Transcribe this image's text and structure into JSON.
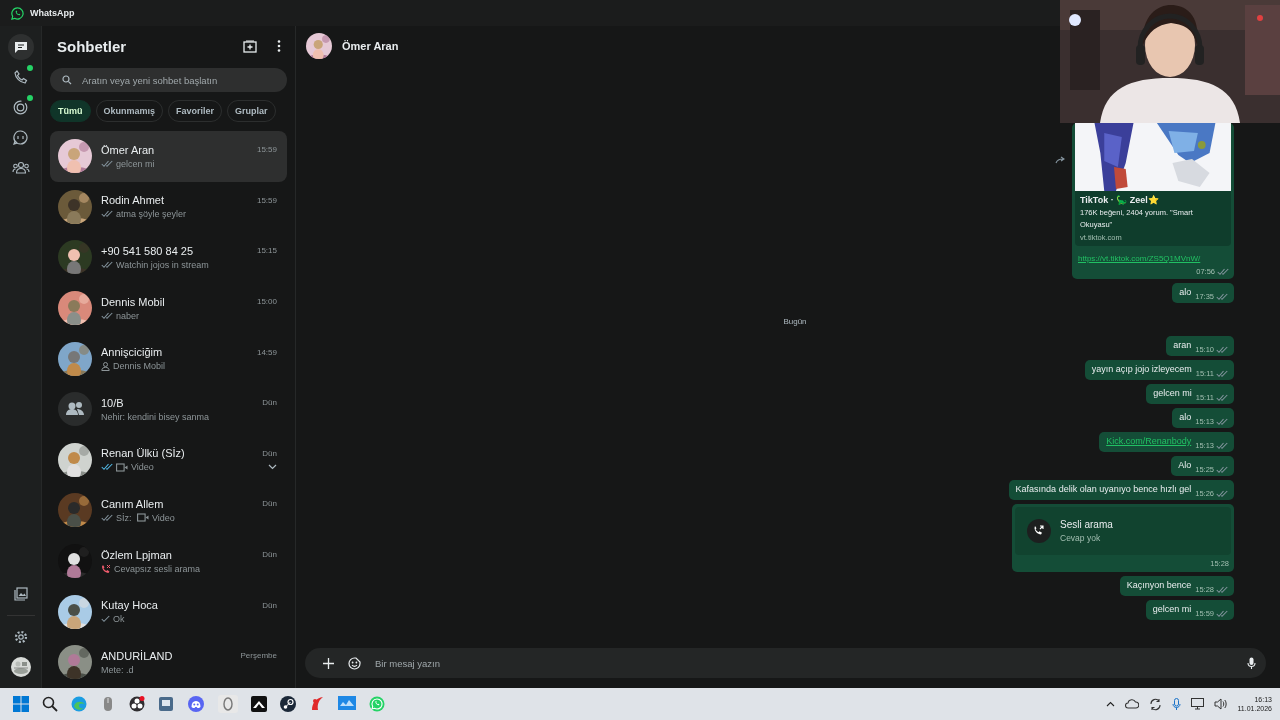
{
  "window": {
    "title": "WhatsApp"
  },
  "rail": {
    "items": [
      {
        "kind": "chats",
        "selected": true,
        "badge": false
      },
      {
        "kind": "calls",
        "selected": false,
        "badge": true
      },
      {
        "kind": "status",
        "selected": false,
        "badge": true
      },
      {
        "kind": "channels",
        "selected": false,
        "badge": false
      },
      {
        "kind": "communities",
        "selected": false,
        "badge": false
      }
    ],
    "bottom": [
      {
        "kind": "media"
      },
      {
        "kind": "settings"
      },
      {
        "kind": "profile"
      }
    ]
  },
  "sidebar": {
    "title": "Sohbetler",
    "search": {
      "placeholder": "Aratın veya yeni sohbet başlatın"
    },
    "filters": [
      {
        "label": "Tümü",
        "selected": true
      },
      {
        "label": "Okunmamış",
        "selected": false
      },
      {
        "label": "Favoriler",
        "selected": false
      },
      {
        "label": "Gruplar",
        "selected": false
      }
    ],
    "chats": [
      {
        "name": "Ömer Aran",
        "time": "15:59",
        "preview": "gelcen mi",
        "sent": true,
        "delivered": true,
        "read": false,
        "selected": true,
        "hovered": false
      },
      {
        "name": "Rodin  Ahmet",
        "time": "15:59",
        "preview": "atma şöyle şeyler",
        "sent": true,
        "delivered": true,
        "read": false,
        "selected": false,
        "hovered": false
      },
      {
        "name": "+90 541 580 84 25",
        "time": "15:15",
        "preview": "Watchin jojos in stream",
        "sent": true,
        "delivered": true,
        "read": false,
        "selected": false,
        "hovered": false
      },
      {
        "name": "Dennis Mobil",
        "time": "15:00",
        "preview": "naber",
        "sent": true,
        "delivered": true,
        "read": false,
        "selected": false,
        "hovered": false
      },
      {
        "name": "Annişciciğim",
        "time": "14:59",
        "preview": "Dennis Mobil",
        "sent": false,
        "preview_icon": {
          "kind": "contact"
        },
        "selected": false,
        "hovered": false
      },
      {
        "name": "10/B",
        "time": "Dün",
        "preview": "Nehir: kendini bisey sanma",
        "sent": false,
        "avatar": {
          "kind": "group"
        },
        "selected": false,
        "hovered": false
      },
      {
        "name": "Renan Ülkü (Sİz)",
        "time": "Dün",
        "preview": "Video",
        "sent": true,
        "delivered": true,
        "read": true,
        "preview_icon": {
          "kind": "video"
        },
        "selected": false,
        "hovered": true
      },
      {
        "name": "Canım Allem",
        "time": "Dün",
        "preview": "Sİz: ",
        "preview_after": "Video",
        "sent": true,
        "delivered": true,
        "read": false,
        "preview_icon": {
          "kind": "video"
        },
        "selected": false,
        "hovered": false
      },
      {
        "name": "Özlem Lpjman",
        "time": "Dün",
        "preview": "Cevapsız sesli arama",
        "sent": false,
        "preview_icon": {
          "kind": "missed-call"
        },
        "selected": false,
        "hovered": false
      },
      {
        "name": "Kutay Hoca",
        "time": "Dün",
        "preview": "Ok",
        "sent": true,
        "delivered": false,
        "read": false,
        "selected": false,
        "hovered": false
      },
      {
        "name": "ANDURİLAND",
        "time": "Perşembe",
        "preview": "Mete: .d",
        "sent": false,
        "selected": false,
        "hovered": false
      }
    ]
  },
  "chat": {
    "contact": "Ömer Aran",
    "messages": [
      {
        "kind": "link_preview",
        "title": "TikTok · 🦕 Zeel⭐",
        "description": "176K beğeni, 2404 yorum. \"Smart Okuyasu\"",
        "domain": "vt.tiktok.com",
        "url": "https://vt.tiktok.com/ZS5Q1MVnW/",
        "time": "07:56",
        "delivered": true,
        "read": false
      },
      {
        "kind": "text",
        "text": "alo",
        "time": "17:35",
        "delivered": true,
        "read": false
      },
      {
        "kind": "date",
        "text": "Bugün"
      },
      {
        "kind": "text",
        "text": "aran",
        "time": "15:10",
        "delivered": true,
        "read": false
      },
      {
        "kind": "text",
        "text": "yayın açıp jojo izleyecem",
        "time": "15:11",
        "delivered": true,
        "read": false
      },
      {
        "kind": "text",
        "text": "gelcen mi",
        "time": "15:11",
        "delivered": true,
        "read": false
      },
      {
        "kind": "text",
        "text": "alo",
        "time": "15:13",
        "delivered": true,
        "read": false
      },
      {
        "kind": "link",
        "text": "Kick.com/Renanbody",
        "time": "15:13",
        "delivered": true,
        "read": false
      },
      {
        "kind": "text",
        "text": "Alo",
        "time": "15:25",
        "delivered": true,
        "read": false
      },
      {
        "kind": "text",
        "text": "Kafasında delik olan uyanıyo bence hızlı gel",
        "time": "15:26",
        "delivered": true,
        "read": false
      },
      {
        "kind": "call",
        "title": "Sesli arama",
        "subtitle": "Cevap yok",
        "time": "15:28"
      },
      {
        "kind": "text",
        "text": "Kaçınyon bence",
        "time": "15:28",
        "delivered": true,
        "read": false
      },
      {
        "kind": "text",
        "text": "gelcen mi",
        "time": "15:59",
        "delivered": true,
        "read": false
      }
    ],
    "composer": {
      "placeholder": "Bir mesaj yazın"
    }
  },
  "taskbar": {
    "time": "16:13",
    "date": "11.01.2026"
  }
}
